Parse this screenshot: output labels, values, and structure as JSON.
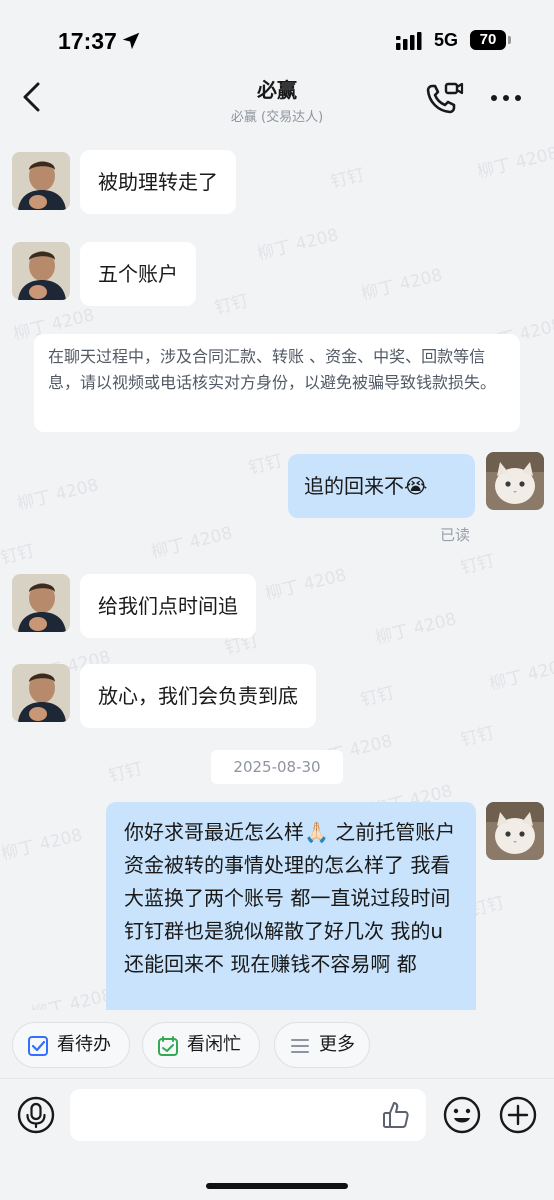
{
  "status_bar": {
    "time": "17:37",
    "network": "5G",
    "battery": "70",
    "icons": [
      "location-arrow-icon",
      "signal-icon"
    ]
  },
  "header": {
    "title": "必赢",
    "subtitle": "必赢 (交易达人)",
    "icons": [
      "back-icon",
      "video-call-icon",
      "more-icon"
    ]
  },
  "watermarks": [
    "钉钉",
    "柳丁 4208"
  ],
  "messages": [
    {
      "side": "in",
      "text": "被助理转走了"
    },
    {
      "side": "in",
      "text": "五个账户"
    },
    {
      "side": "notice",
      "text": "在聊天过程中，涉及合同汇款、转账 、资金、中奖、回款等信息，请以视频或电话核实对方身份，以避免被骗导致钱款损失。"
    },
    {
      "side": "out",
      "text": "追的回来不",
      "emoji": "😭",
      "status": "已读"
    },
    {
      "side": "in",
      "text": "给我们点时间追"
    },
    {
      "side": "in",
      "text": "放心，我们会负责到底"
    },
    {
      "side": "date",
      "text": "2025-08-30"
    },
    {
      "side": "out",
      "text": "你好求哥最近怎么样🙏🏻 之前托管账户资金被转的事情处理的怎么样了 我看大蓝换了两个账号 都一直说过段时间 钉钉群也是貌似解散了好几次 我的u还能回来不 现在赚钱不容易啊 都"
    }
  ],
  "quick_actions": [
    {
      "label": "看待办",
      "icon": "checkbox-icon"
    },
    {
      "label": "看闲忙",
      "icon": "calendar-check-icon"
    },
    {
      "label": "更多",
      "icon": "menu-lines-icon"
    }
  ],
  "input": {
    "placeholder": ""
  },
  "colors": {
    "accent": "#3370ff",
    "green": "#34a853",
    "out_bubble": "#c8e3fb",
    "bg": "#f2f3f5"
  }
}
